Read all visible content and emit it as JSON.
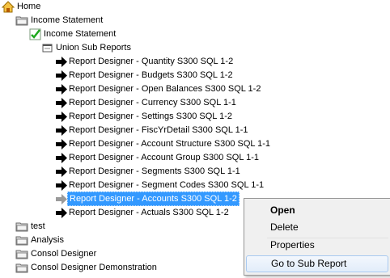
{
  "tree": {
    "root": "Home",
    "level1": [
      {
        "label": "Income Statement"
      },
      {
        "label": "test"
      },
      {
        "label": "Analysis"
      },
      {
        "label": "Consol Designer"
      },
      {
        "label": "Consol Designer Demonstration"
      }
    ],
    "income_statement_child": "Income Statement",
    "union_sub_reports": "Union Sub Reports",
    "reports": [
      "Report Designer - Quantity S300 SQL 1-2",
      "Report Designer - Budgets S300 SQL 1-2",
      "Report Designer - Open Balances S300 SQL 1-2",
      "Report Designer - Currency S300 SQL 1-1",
      "Report Designer - Settings S300 SQL 1-2",
      "Report Designer - FiscYrDetail S300 SQL 1-1",
      "Report Designer - Account Structure S300 SQL 1-1",
      "Report Designer - Account Group S300 SQL 1-1",
      "Report Designer - Segments S300 SQL 1-1",
      "Report Designer - Segment Codes S300 SQL 1-1",
      "Report Designer - Accounts S300 SQL 1-2",
      "Report Designer - Actuals S300 SQL 1-2"
    ]
  },
  "context_menu": {
    "open": "Open",
    "delete": "Delete",
    "properties": "Properties",
    "go_to_sub_report": "Go to Sub Report"
  },
  "colors": {
    "selection": "#3399ff",
    "menu_background": "#f0f0f0"
  }
}
